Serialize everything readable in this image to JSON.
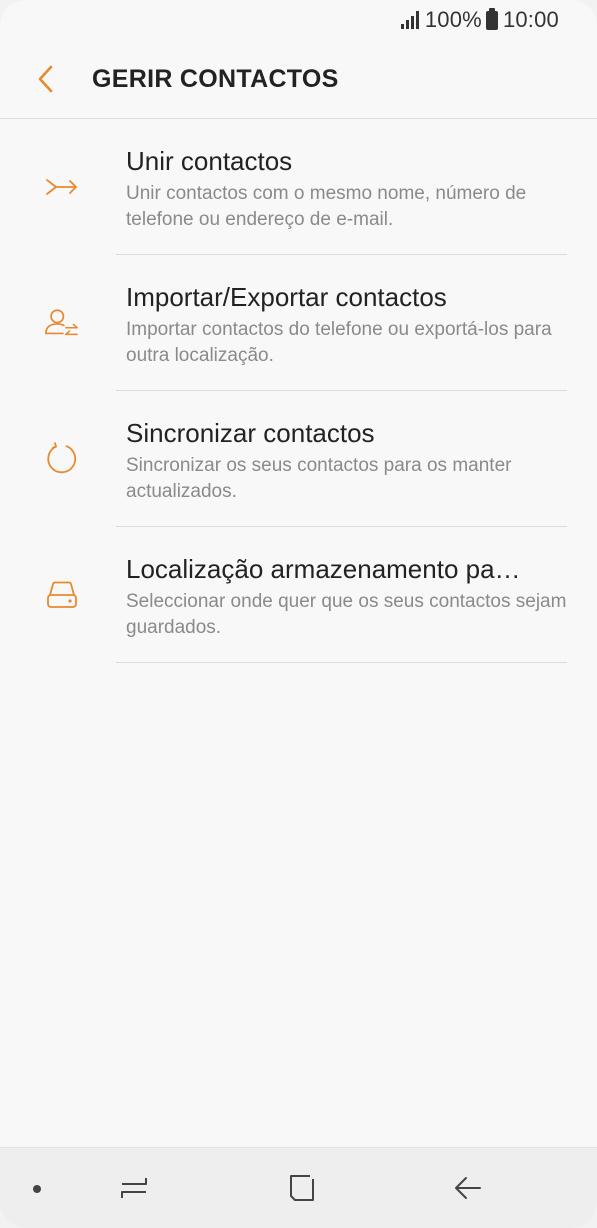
{
  "status_bar": {
    "battery": "100%",
    "time": "10:00"
  },
  "header": {
    "title": "GERIR CONTACTOS"
  },
  "accent_color": "#e8892f",
  "items": [
    {
      "icon": "merge-arrow-icon",
      "title": "Unir contactos",
      "subtitle": "Unir contactos com o mesmo nome, número de telefone ou endereço de e-mail."
    },
    {
      "icon": "person-transfer-icon",
      "title": "Importar/Exportar contactos",
      "subtitle": "Importar contactos do telefone ou exportá-los para outra localização."
    },
    {
      "icon": "sync-icon",
      "title": "Sincronizar contactos",
      "subtitle": "Sincronizar os seus contactos para os manter actualizados."
    },
    {
      "icon": "storage-drive-icon",
      "title": "Localização armazenamento pa…",
      "subtitle": "Seleccionar onde quer que os seus contactos sejam guardados."
    }
  ],
  "nav_bar": {
    "buttons": [
      "recent-apps",
      "home",
      "back"
    ]
  }
}
